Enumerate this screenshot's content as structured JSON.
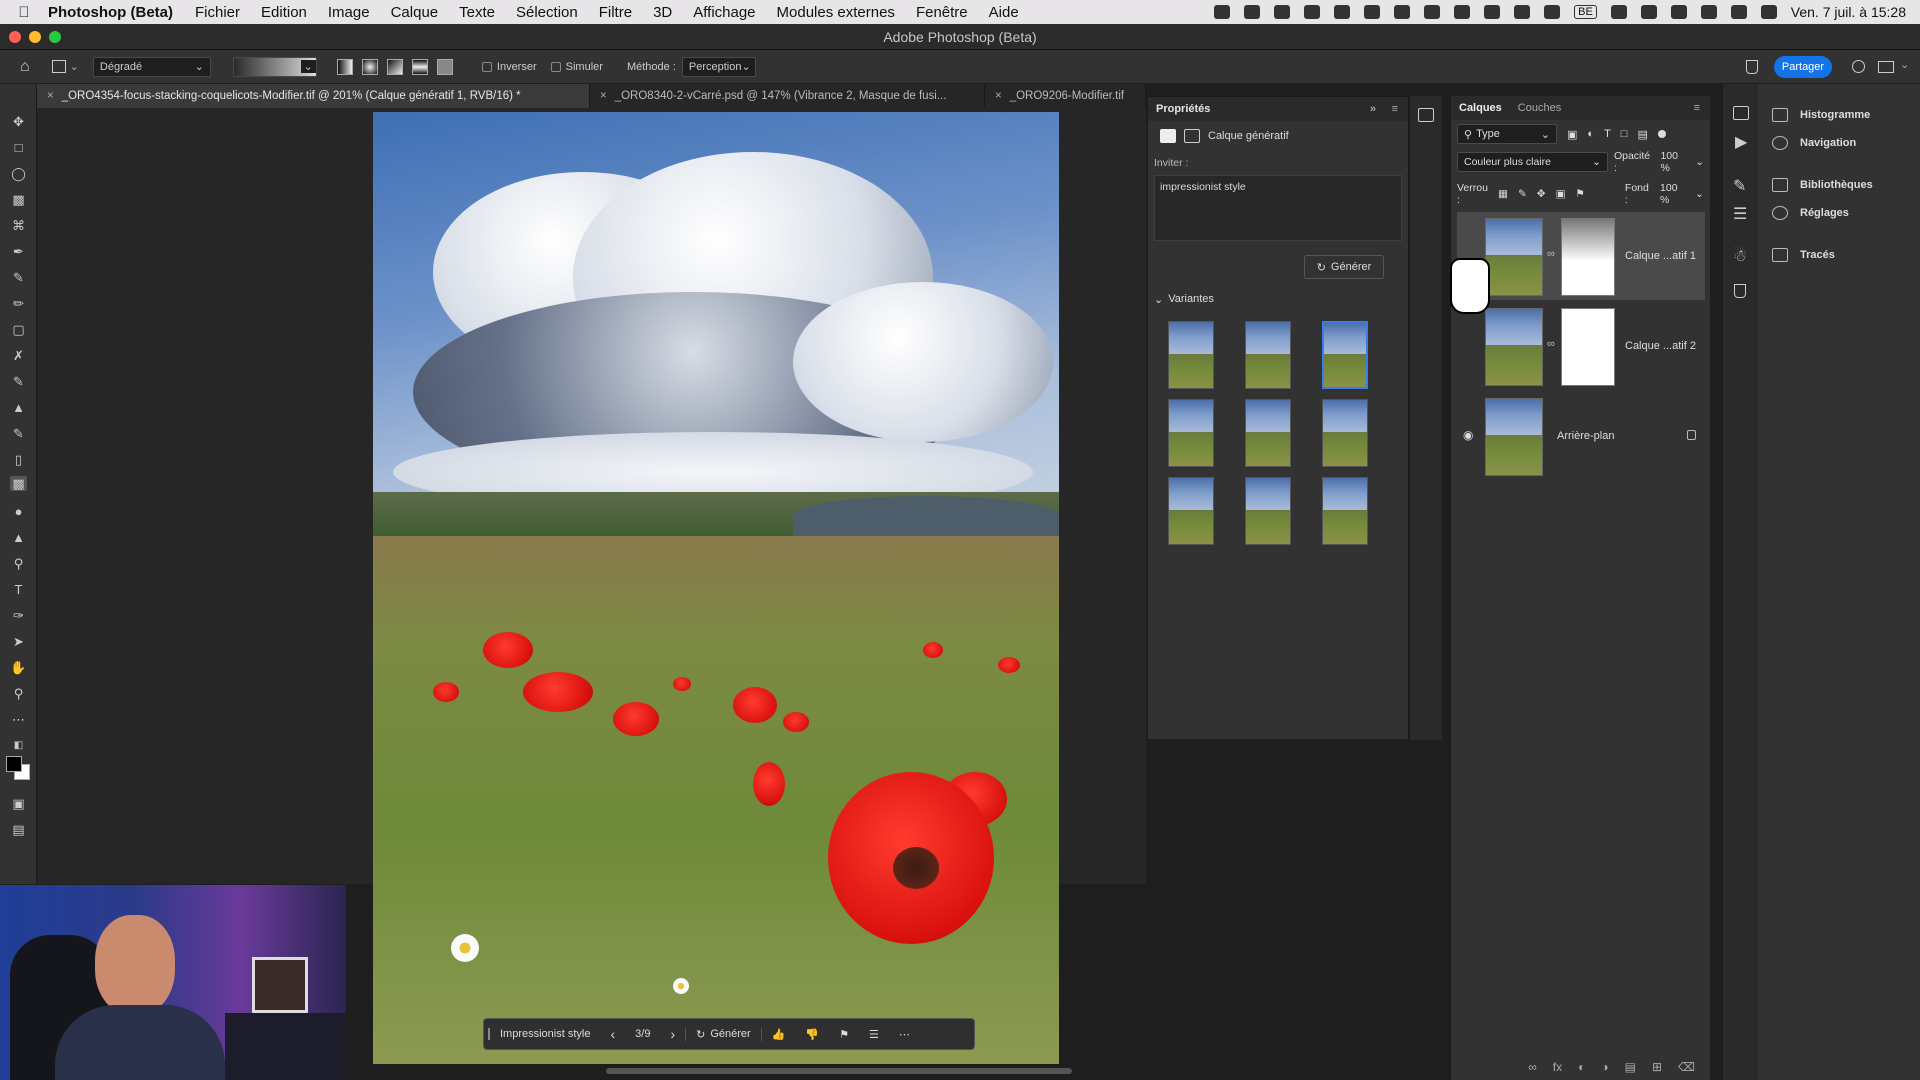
{
  "menubar": {
    "app": "Photoshop (Beta)",
    "items": [
      "Fichier",
      "Edition",
      "Image",
      "Calque",
      "Texte",
      "Sélection",
      "Filtre",
      "3D",
      "Affichage",
      "Modules externes",
      "Fenêtre",
      "Aide"
    ],
    "datetime": "Ven. 7 juil. à 15:28",
    "kb": "BE"
  },
  "window": {
    "title": "Adobe Photoshop (Beta)"
  },
  "options": {
    "gradient_type": "Dégradé",
    "invert_label": "Inverser",
    "simulate_label": "Simuler",
    "method_label": "Méthode :",
    "method_value": "Perception",
    "share_label": "Partager"
  },
  "tabs": [
    {
      "label": "_ORO4354-focus-stacking-coquelicots-Modifier.tif @ 201% (Calque génératif 1, RVB/16) *",
      "active": true
    },
    {
      "label": "_ORO8340-2-vCarré.psd @ 147% (Vibrance 2, Masque de fusi...",
      "active": false
    },
    {
      "label": "_ORO9206-Modifier.tif",
      "active": false
    }
  ],
  "genbar": {
    "prompt": "Impressionist style",
    "counter": "3/9",
    "generate_label": "Générer"
  },
  "properties": {
    "title": "Propriétés",
    "layer_type": "Calque génératif",
    "prompt_label": "Inviter :",
    "prompt_value": "impressionist style",
    "generate_label": "Générer",
    "variants_label": "Variantes",
    "variants_count": 9,
    "selected_variant": 3
  },
  "layers": {
    "tabs": [
      "Calques",
      "Couches"
    ],
    "filter_label": "Type",
    "blend_mode": "Couleur plus claire",
    "opacity_label": "Opacité :",
    "opacity_value": "100 %",
    "lock_label": "Verrou :",
    "fill_label": "Fond :",
    "fill_value": "100 %",
    "items": [
      {
        "name": "Calque ...atif 1",
        "selected": true,
        "visible": false
      },
      {
        "name": "Calque ...atif 2",
        "selected": false,
        "visible": false
      },
      {
        "name": "Arrière-plan",
        "selected": false,
        "visible": true,
        "locked": true
      }
    ]
  },
  "right_panels": [
    "Histogramme",
    "Navigation",
    "Bibliothèques",
    "Réglages",
    "Tracés"
  ],
  "colors": {
    "accent": "#1473e6",
    "selection": "#3b7de8",
    "poppy": "#e0140f"
  }
}
